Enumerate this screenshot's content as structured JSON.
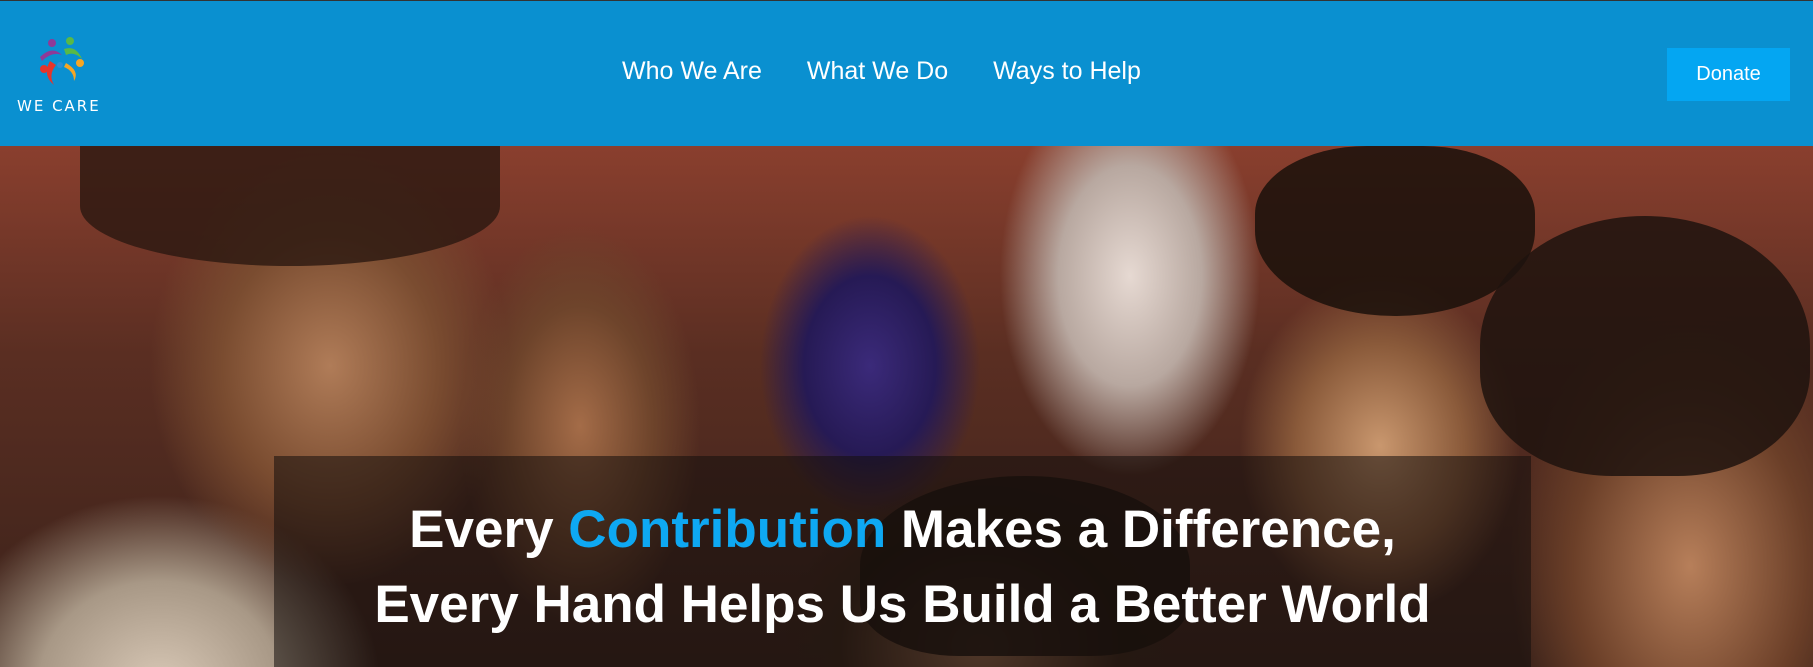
{
  "brand": {
    "name": "WE CARE",
    "logo_icon": "people-circle-logo-icon",
    "colors": [
      "#e5352b",
      "#f6a623",
      "#58b947",
      "#2a8fd6",
      "#8e3a98"
    ]
  },
  "nav": {
    "items": [
      {
        "label": "Who We Are"
      },
      {
        "label": "What We Do"
      },
      {
        "label": "Ways to Help"
      }
    ]
  },
  "header": {
    "donate_label": "Donate",
    "background": "#0a90d0",
    "donate_background": "#04a6f2"
  },
  "hero": {
    "line1_before": "Every ",
    "line1_accent": "Contribution",
    "line1_after": " Makes a Difference,",
    "line2": "Every Hand Helps Us Build a Better World",
    "accent_color": "#0ea8f2"
  }
}
